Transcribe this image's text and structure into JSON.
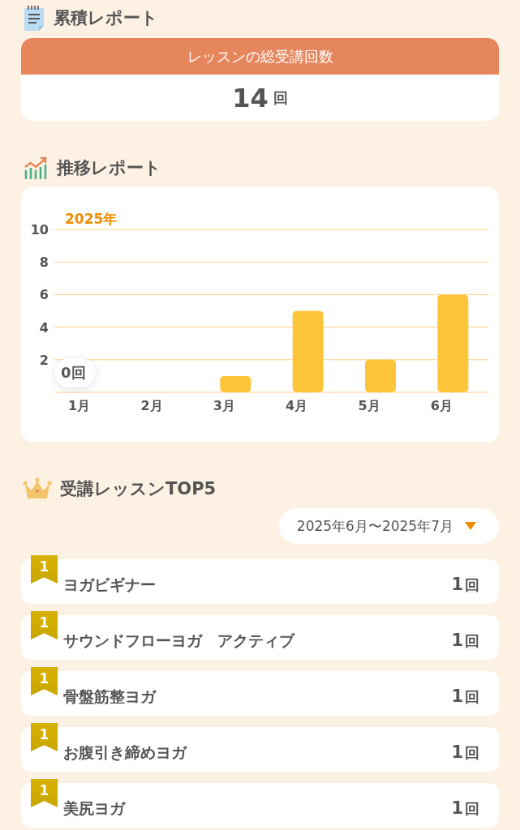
{
  "cumulative": {
    "heading": "累積レポート",
    "card_title": "レッスンの総受講回数",
    "count": "14",
    "unit": "回"
  },
  "trend": {
    "heading": "推移レポート",
    "year_label": "2025年",
    "tooltip": "0回",
    "chart_data": {
      "type": "bar",
      "categories": [
        "1月",
        "2月",
        "3月",
        "4月",
        "5月",
        "6月"
      ],
      "values": [
        0,
        0,
        1,
        5,
        2,
        6
      ],
      "ylim": [
        0,
        10
      ],
      "grid": true,
      "yticks": [
        2,
        4,
        6,
        8,
        10
      ]
    }
  },
  "ranking": {
    "heading": "受講レッスンTOP5",
    "period": "2025年6月〜2025年7月",
    "items": [
      {
        "rank": "1",
        "name": "ヨガビギナー",
        "count": "1",
        "unit": "回"
      },
      {
        "rank": "1",
        "name": "サウンドフローヨガ　アクティブ",
        "count": "1",
        "unit": "回"
      },
      {
        "rank": "1",
        "name": "骨盤筋整ヨガ",
        "count": "1",
        "unit": "回"
      },
      {
        "rank": "1",
        "name": "お腹引き締めヨガ",
        "count": "1",
        "unit": "回"
      },
      {
        "rank": "1",
        "name": "美尻ヨガ",
        "count": "1",
        "unit": "回"
      }
    ]
  }
}
